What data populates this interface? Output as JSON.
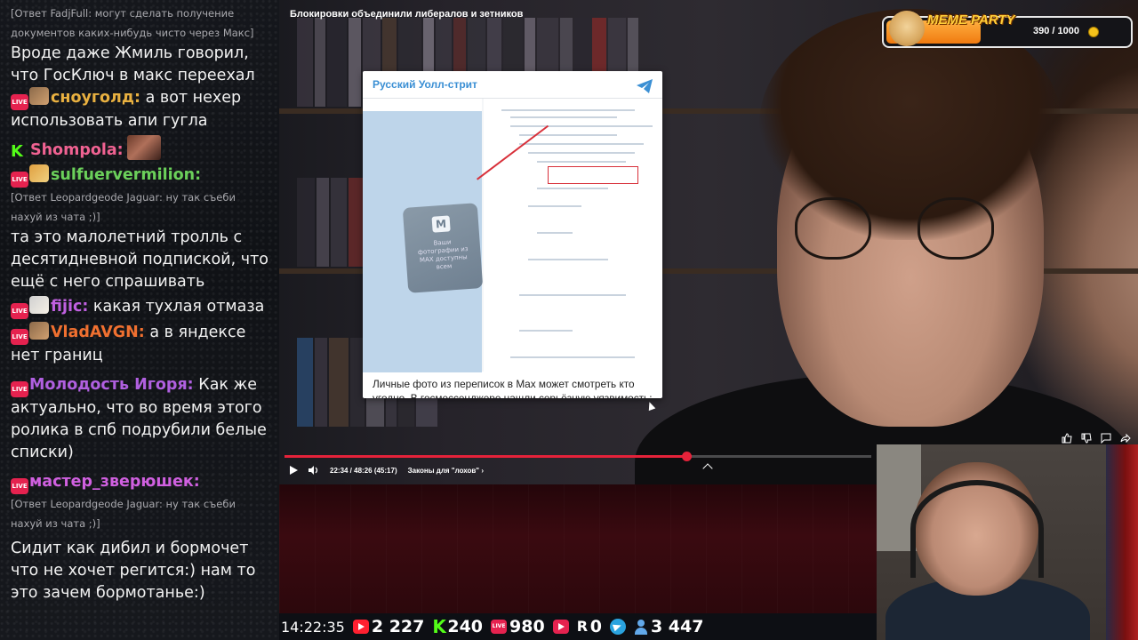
{
  "chat": {
    "messages": [
      {
        "reply": "[Ответ FadjFull: могут сделать получение документов каких-нибудь чисто через Макс]"
      },
      {
        "text": "Вроде даже Жмиль говорил, что ГосКлюч в макс переехал"
      },
      {
        "platform": "live",
        "user": "сноуголд:",
        "color": "#e8b040",
        "text": "а вот нехер использовать апи гугла"
      },
      {
        "platform": "kick",
        "user": "Shompola:",
        "color": "#f06292",
        "text": ""
      },
      {
        "platform": "live",
        "user": "sulfuervermilion:",
        "color": "#6bd05a",
        "text": ""
      },
      {
        "reply": "[Ответ Leopardgeode Jaguar: ну так съеби нахуй из чата ;)]"
      },
      {
        "text": "та это малолетний тролль с десятидневной подпиской, что ещё с него спрашивать"
      },
      {
        "platform": "live",
        "user": "fijic:",
        "color": "#c060e0",
        "text": "какая тухлая отмаза"
      },
      {
        "platform": "live",
        "user": "VladAVGN:",
        "color": "#f07030",
        "text": "а в яндексе нет границ"
      },
      {
        "platform": "live",
        "user": "Молодость Игоря:",
        "color": "#b060e0",
        "text": "Как же актуально, что во время этого ролика в спб подрубили белые списки)"
      },
      {
        "platform": "live",
        "user": "мастер_зверюшек:",
        "color": "#d060e0",
        "text": ""
      },
      {
        "reply": "[Ответ Leopardgeode Jaguar: ну так съеби нахуй из чата ;)]"
      },
      {
        "text": "Сидит как дибил и бормочет что не хочет регится:) нам то это зачем бормотанье:)"
      }
    ],
    "live_badge": "LIVE",
    "kick_badge": "K"
  },
  "video": {
    "title": "Блокировки объединили либералов и зетников",
    "card": {
      "channel": "Русский Уолл-стрит",
      "phone_text": "Ваши фотографии из MAX доступны всем",
      "body": "Личные фото из переписок в Max может смотреть кто угодно. В госмессенджере нашли серьёзную уязвимость: если знать прямую ссылку на изображение из веб-версии, его можно открыть без авторизации. Фактически файлы работают как обычные ссылки на хостинг."
    },
    "time": "22:34 / 48:26 (45:17)",
    "chapter": "Законы для \"лохов\" ›",
    "progress_played": 0.685
  },
  "meme_party": {
    "title": "MEME PARTY",
    "score": "390 / 1000",
    "fill": 0.39
  },
  "status_bar": {
    "clock": "14:22:35",
    "youtube": "2 227",
    "kick": "240",
    "vk": "980",
    "rutube": "0",
    "telegram": "",
    "viewers": "3 447"
  },
  "colors": {
    "accent_red": "#e5223a",
    "live": "#e5224f",
    "kick": "#53fc18",
    "telegram": "#3a8fd4"
  }
}
